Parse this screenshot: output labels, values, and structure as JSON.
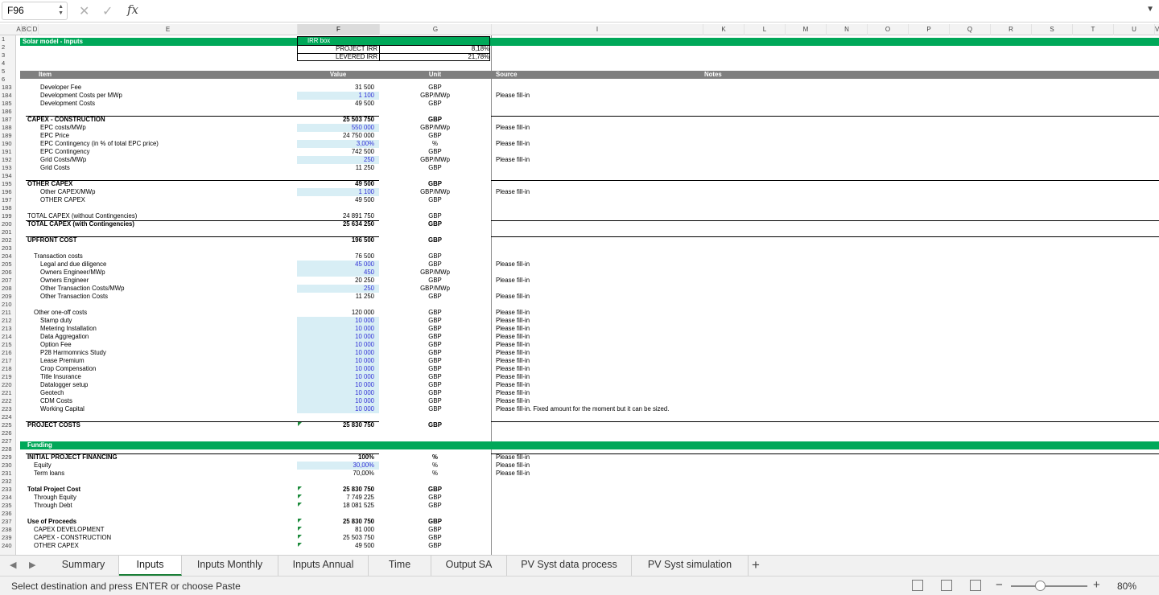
{
  "name_box": "F96",
  "formula_bar": {
    "cancel": "✕",
    "confirm": "✓",
    "fx": "fx",
    "value": "",
    "dropdown": "▼"
  },
  "columns": [
    "A",
    "B",
    "C",
    "D",
    "E",
    "F",
    "G",
    "I",
    "K",
    "L",
    "M",
    "N",
    "O",
    "P",
    "Q",
    "R",
    "S",
    "T",
    "U",
    "V"
  ],
  "irr_box": {
    "title": "IRR box",
    "project_irr_label": "PROJECT IRR",
    "project_irr": "8,18%",
    "levered_irr_label": "LEVERED IRR",
    "levered_irr": "21,78%"
  },
  "section_inputs": "Solar model - Inputs",
  "header": {
    "item": "Item",
    "value": "Value",
    "unit": "Unit",
    "source": "Source",
    "notes": "Notes"
  },
  "section_funding": "Funding",
  "rows": [
    {
      "n": "1"
    },
    {
      "n": "2"
    },
    {
      "n": "3"
    },
    {
      "n": "4"
    },
    {
      "n": "5"
    },
    {
      "n": "6"
    },
    {
      "n": "183",
      "item": "Developer Fee",
      "value": "31 500",
      "unit": "GBP"
    },
    {
      "n": "184",
      "item": "Development Costs per MWp",
      "value": "1 100",
      "unit": "GBP/MWp",
      "source": "Please fill-in"
    },
    {
      "n": "185",
      "item": "Development Costs",
      "value": "49 500",
      "unit": "GBP"
    },
    {
      "n": "186"
    },
    {
      "n": "187",
      "item": "CAPEX - CONSTRUCTION",
      "value": "25 503 750",
      "unit": "GBP"
    },
    {
      "n": "188",
      "item": "EPC costs/MWp",
      "value": "550 000",
      "unit": "GBP/MWp",
      "source": "Please fill-in"
    },
    {
      "n": "189",
      "item": "EPC Price",
      "value": "24 750 000",
      "unit": "GBP"
    },
    {
      "n": "190",
      "item": "EPC Contingency (in % of total EPC price)",
      "value": "3,00%",
      "unit": "%",
      "source": "Please fill-in"
    },
    {
      "n": "191",
      "item": "EPC Contingency",
      "value": "742 500",
      "unit": "GBP"
    },
    {
      "n": "192",
      "item": "Grid Costs/MWp",
      "value": "250",
      "unit": "GBP/MWp",
      "source": "Please fill-in"
    },
    {
      "n": "193",
      "item": "Grid Costs",
      "value": "11 250",
      "unit": "GBP"
    },
    {
      "n": "194"
    },
    {
      "n": "195",
      "item": "OTHER CAPEX",
      "value": "49 500",
      "unit": "GBP"
    },
    {
      "n": "196",
      "item": "Other CAPEX/MWp",
      "value": "1 100",
      "unit": "GBP/MWp",
      "source": "Please fill-in"
    },
    {
      "n": "197",
      "item": "OTHER CAPEX",
      "value": "49 500",
      "unit": "GBP"
    },
    {
      "n": "198"
    },
    {
      "n": "199",
      "item": "TOTAL CAPEX (without Contingencies)",
      "value": "24 891 750",
      "unit": "GBP"
    },
    {
      "n": "200",
      "item": "TOTAL CAPEX (with Contingencies)",
      "value": "25 634 250",
      "unit": "GBP"
    },
    {
      "n": "201"
    },
    {
      "n": "202",
      "item": "UPFRONT COST",
      "value": "196 500",
      "unit": "GBP"
    },
    {
      "n": "203"
    },
    {
      "n": "204",
      "item": "Transaction costs",
      "value": "76 500",
      "unit": "GBP"
    },
    {
      "n": "205",
      "item": "Legal and due diligence",
      "value": "45 000",
      "unit": "GBP",
      "source": "Please fill-in"
    },
    {
      "n": "206",
      "item": "Owners Engineer/MWp",
      "value": "450",
      "unit": "GBP/MWp"
    },
    {
      "n": "207",
      "item": "Owners Engineer",
      "value": "20 250",
      "unit": "GBP",
      "source": "Please fill-in"
    },
    {
      "n": "208",
      "item": "Other Transaction Costs/MWp",
      "value": "250",
      "unit": "GBP/MWp"
    },
    {
      "n": "209",
      "item": "Other Transaction Costs",
      "value": "11 250",
      "unit": "GBP",
      "source": "Please fill-in"
    },
    {
      "n": "210"
    },
    {
      "n": "211",
      "item": "Other one-off costs",
      "value": "120 000",
      "unit": "GBP",
      "source": "Please fill-in"
    },
    {
      "n": "212",
      "item": "Stamp duty",
      "value": "10 000",
      "unit": "GBP",
      "source": "Please fill-in"
    },
    {
      "n": "213",
      "item": "Metering Installation",
      "value": "10 000",
      "unit": "GBP",
      "source": "Please fill-in"
    },
    {
      "n": "214",
      "item": "Data Aggregation",
      "value": "10 000",
      "unit": "GBP",
      "source": "Please fill-in"
    },
    {
      "n": "215",
      "item": "Option Fee",
      "value": "10 000",
      "unit": "GBP",
      "source": "Please fill-in"
    },
    {
      "n": "216",
      "item": "P28 Harmomnics Study",
      "value": "10 000",
      "unit": "GBP",
      "source": "Please fill-in"
    },
    {
      "n": "217",
      "item": "Lease Premium",
      "value": "10 000",
      "unit": "GBP",
      "source": "Please fill-in"
    },
    {
      "n": "218",
      "item": "Crop Compensation",
      "value": "10 000",
      "unit": "GBP",
      "source": "Please fill-in"
    },
    {
      "n": "219",
      "item": "Title Insurance",
      "value": "10 000",
      "unit": "GBP",
      "source": "Please fill-in"
    },
    {
      "n": "220",
      "item": "Datalogger setup",
      "value": "10 000",
      "unit": "GBP",
      "source": "Please fill-in"
    },
    {
      "n": "221",
      "item": "Geotech",
      "value": "10 000",
      "unit": "GBP",
      "source": "Please fill-in"
    },
    {
      "n": "222",
      "item": "CDM Costs",
      "value": "10 000",
      "unit": "GBP",
      "source": "Please fill-in"
    },
    {
      "n": "223",
      "item": "Working Capital",
      "value": "10 000",
      "unit": "GBP",
      "source": "Please fill-in. Fixed amount for the moment but it can be sized."
    },
    {
      "n": "224"
    },
    {
      "n": "225",
      "item": "PROJECT COSTS",
      "value": "25 830 750",
      "unit": "GBP"
    },
    {
      "n": "226"
    },
    {
      "n": "227"
    },
    {
      "n": "228"
    },
    {
      "n": "229",
      "item": "INITIAL PROJECT FINANCING",
      "value": "100%",
      "unit": "%",
      "source": "Please fill-in"
    },
    {
      "n": "230",
      "item": "Equity",
      "value": "30,00%",
      "unit": "%",
      "source": "Please fill-in"
    },
    {
      "n": "231",
      "item": "Term loans",
      "value": "70,00%",
      "unit": "%",
      "source": "Please fill-in"
    },
    {
      "n": "232"
    },
    {
      "n": "233",
      "item": "Total Project Cost",
      "value": "25 830 750",
      "unit": "GBP"
    },
    {
      "n": "234",
      "item": "Through Equity",
      "value": "7 749 225",
      "unit": "GBP"
    },
    {
      "n": "235",
      "item": "Through Debt",
      "value": "18 081 525",
      "unit": "GBP"
    },
    {
      "n": "236"
    },
    {
      "n": "237",
      "item": "Use of Proceeds",
      "value": "25 830 750",
      "unit": "GBP"
    },
    {
      "n": "238",
      "item": "CAPEX DEVELOPMENT",
      "value": "81 000",
      "unit": "GBP"
    },
    {
      "n": "239",
      "item": "CAPEX - CONSTRUCTION",
      "value": "25 503 750",
      "unit": "GBP"
    },
    {
      "n": "240",
      "item": "OTHER CAPEX",
      "value": "49 500",
      "unit": "GBP"
    }
  ],
  "tabs": [
    "Summary",
    "Inputs",
    "Inputs Monthly",
    "Inputs Annual",
    "Time",
    "Output SA",
    "PV Syst data process",
    "PV Syst simulation"
  ],
  "active_tab": "Inputs",
  "add_sheet": "+",
  "status": {
    "message": "Select destination and press ENTER or choose Paste",
    "zoom": "80%",
    "zoom_minus": "−",
    "zoom_plus": "+"
  }
}
